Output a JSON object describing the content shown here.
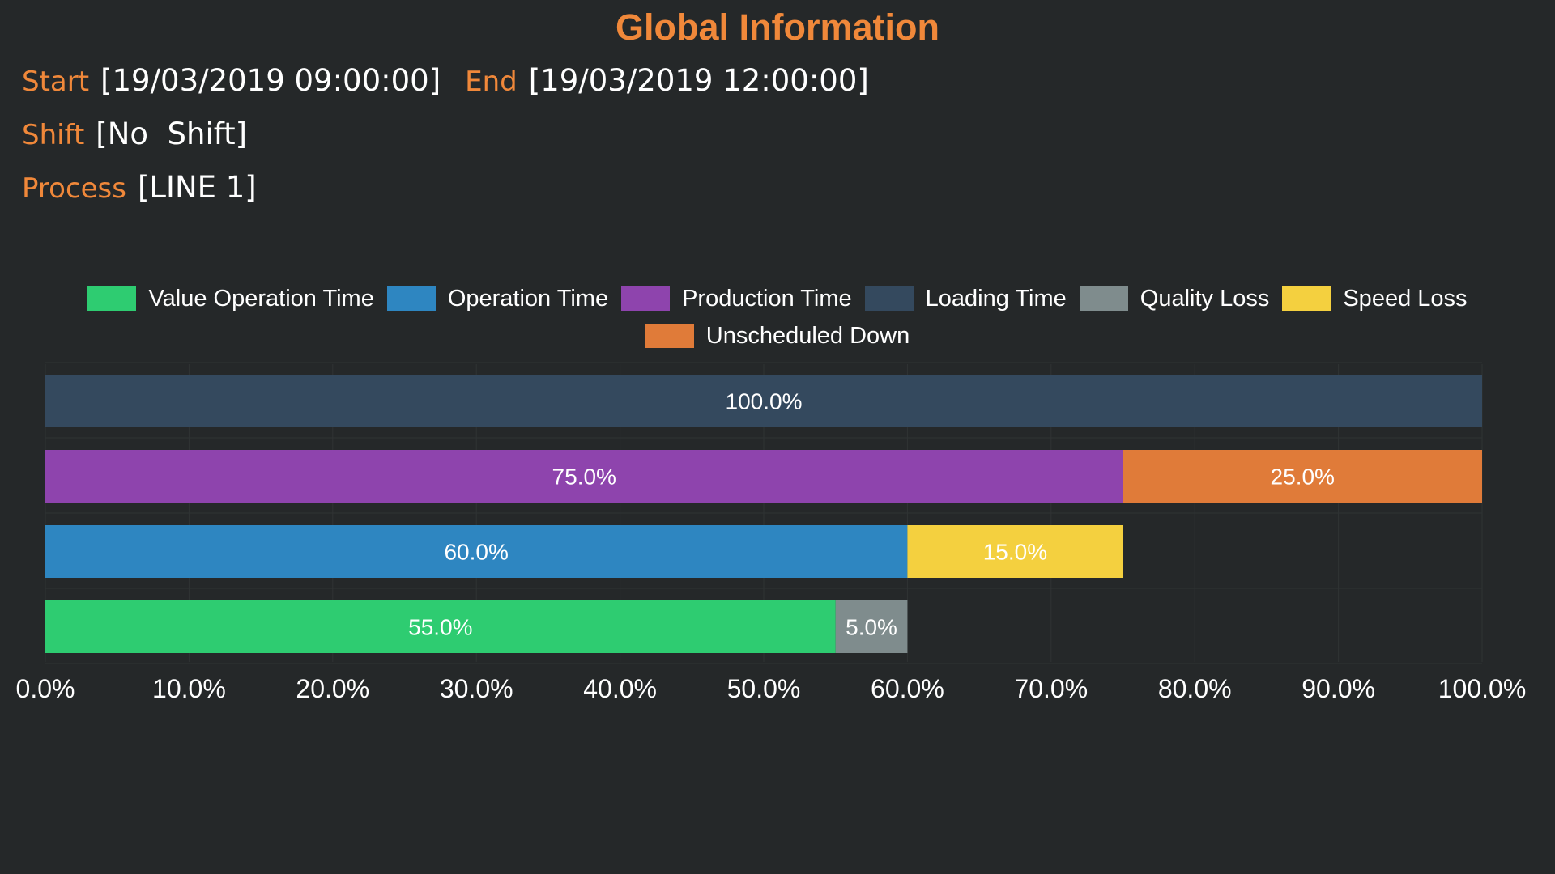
{
  "header": {
    "title": "Global Information",
    "start_label": "Start",
    "start_value": "[19/03/2019 09:00:00]",
    "end_label": "End",
    "end_value": "[19/03/2019 12:00:00]",
    "shift_label": "Shift",
    "shift_value": "[No  Shift]",
    "process_label": "Process",
    "process_value": "[LINE 1]"
  },
  "colors": {
    "background": "#252829",
    "accent": "#f0883a",
    "text": "#ffffff",
    "grid": "#2f3334"
  },
  "chart_data": {
    "type": "bar",
    "orientation": "horizontal",
    "stacked": true,
    "legend_position": "top",
    "grid": true,
    "xlim": [
      0,
      100
    ],
    "x_ticks": [
      "0.0%",
      "10.0%",
      "20.0%",
      "30.0%",
      "40.0%",
      "50.0%",
      "60.0%",
      "70.0%",
      "80.0%",
      "90.0%",
      "100.0%"
    ],
    "legend": [
      {
        "name": "Value Operation Time",
        "color": "#2ecc71"
      },
      {
        "name": "Operation Time",
        "color": "#2e86c1"
      },
      {
        "name": "Production Time",
        "color": "#8e44ad"
      },
      {
        "name": "Loading Time",
        "color": "#34495e"
      },
      {
        "name": "Quality Loss",
        "color": "#7f8c8d"
      },
      {
        "name": "Speed Loss",
        "color": "#f4d03f"
      },
      {
        "name": "Unscheduled Down",
        "color": "#e07b39"
      }
    ],
    "bars": [
      {
        "segments": [
          {
            "series": "Loading Time",
            "value": 100.0,
            "label": "100.0%",
            "color": "#34495e"
          }
        ]
      },
      {
        "segments": [
          {
            "series": "Production Time",
            "value": 75.0,
            "label": "75.0%",
            "color": "#8e44ad"
          },
          {
            "series": "Unscheduled Down",
            "value": 25.0,
            "label": "25.0%",
            "color": "#e07b39"
          }
        ]
      },
      {
        "segments": [
          {
            "series": "Operation Time",
            "value": 60.0,
            "label": "60.0%",
            "color": "#2e86c1"
          },
          {
            "series": "Speed Loss",
            "value": 15.0,
            "label": "15.0%",
            "color": "#f4d03f"
          }
        ]
      },
      {
        "segments": [
          {
            "series": "Value Operation Time",
            "value": 55.0,
            "label": "55.0%",
            "color": "#2ecc71"
          },
          {
            "series": "Quality Loss",
            "value": 5.0,
            "label": "5.0%",
            "color": "#7f8c8d"
          }
        ]
      }
    ]
  }
}
